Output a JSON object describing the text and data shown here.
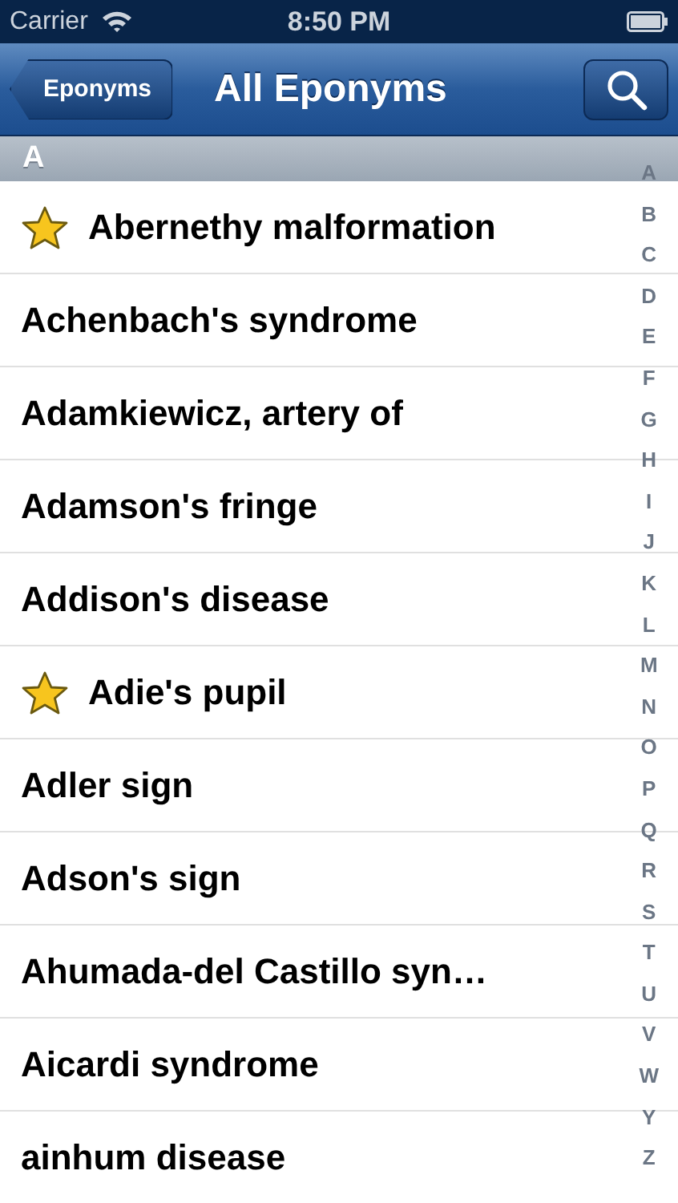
{
  "status_bar": {
    "carrier": "Carrier",
    "time": "8:50 PM"
  },
  "nav_bar": {
    "back_button": "Eponyms",
    "title": "All Eponyms"
  },
  "section_header": "A",
  "rows": [
    {
      "label": "Abernethy malformation",
      "favorite": true
    },
    {
      "label": "Achenbach's syndrome",
      "favorite": false
    },
    {
      "label": "Adamkiewicz, artery of",
      "favorite": false
    },
    {
      "label": "Adamson's fringe",
      "favorite": false
    },
    {
      "label": "Addison's disease",
      "favorite": false
    },
    {
      "label": "Adie's pupil",
      "favorite": true
    },
    {
      "label": "Adler sign",
      "favorite": false
    },
    {
      "label": "Adson's sign",
      "favorite": false
    },
    {
      "label": "Ahumada-del Castillo syn…",
      "favorite": false
    },
    {
      "label": "Aicardi syndrome",
      "favorite": false
    },
    {
      "label": "ainhum disease",
      "favorite": false
    }
  ],
  "index_letters": [
    "A",
    "B",
    "C",
    "D",
    "E",
    "F",
    "G",
    "H",
    "I",
    "J",
    "K",
    "L",
    "M",
    "N",
    "O",
    "P",
    "Q",
    "R",
    "S",
    "T",
    "U",
    "V",
    "W",
    "Y",
    "Z"
  ]
}
